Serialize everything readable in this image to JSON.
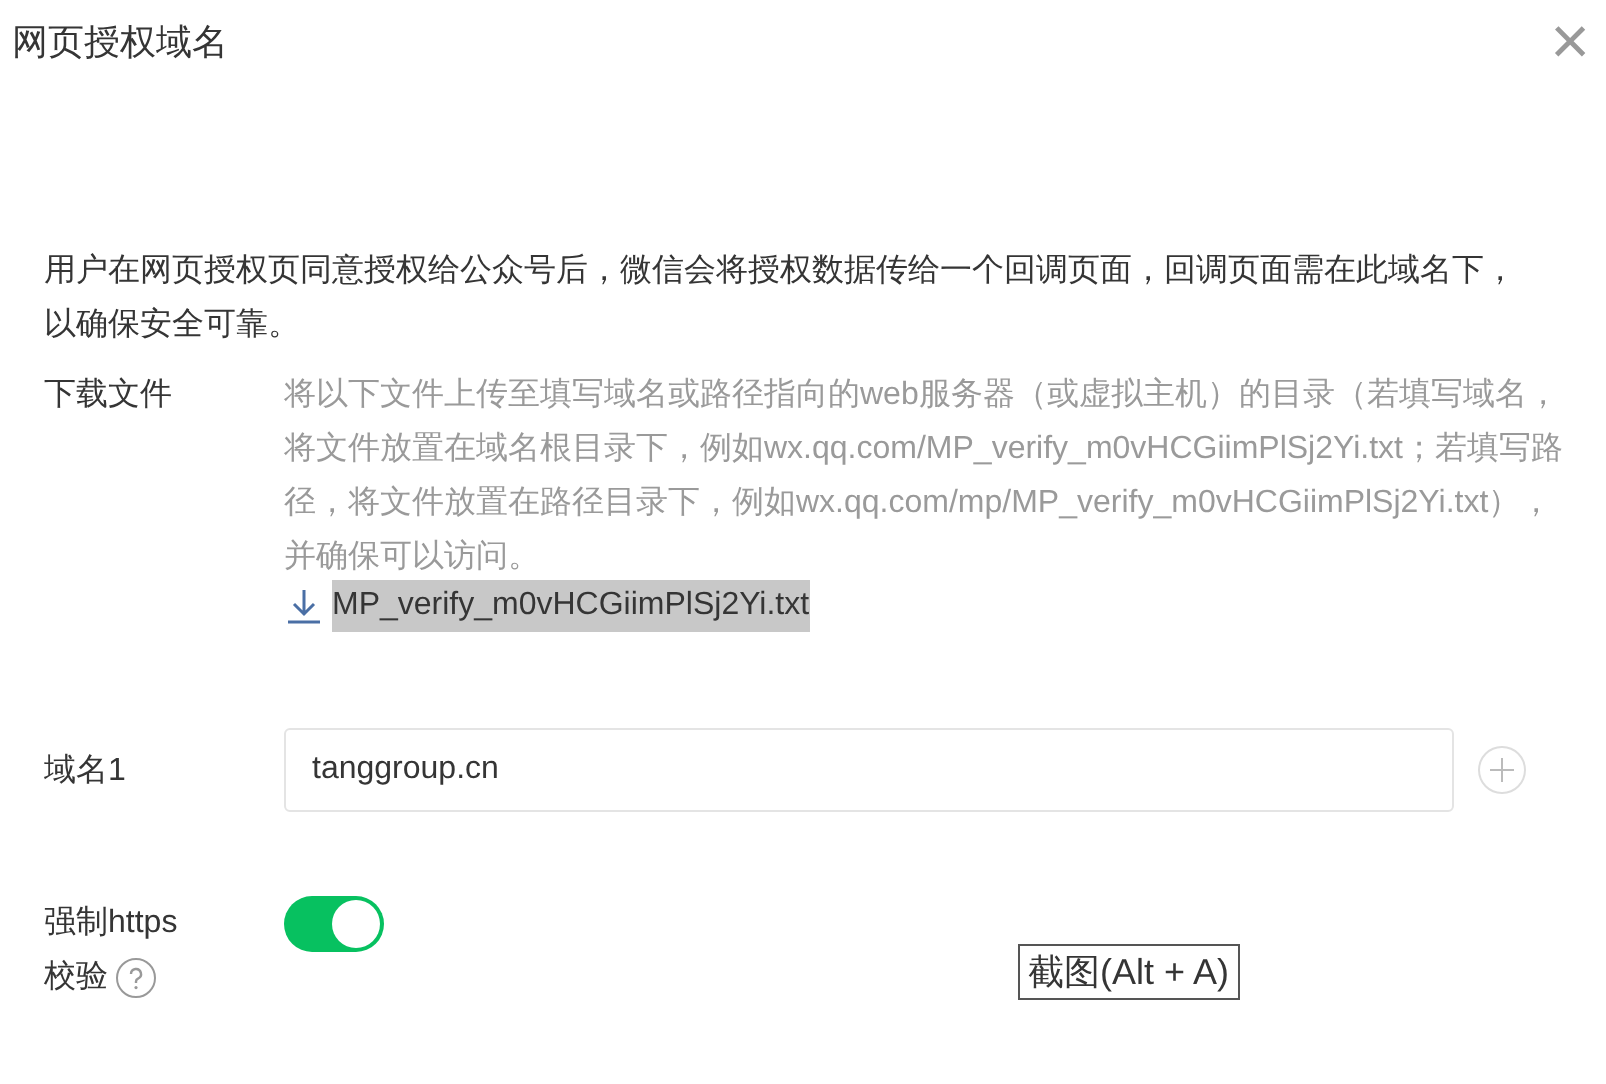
{
  "dialog": {
    "title": "网页授权域名",
    "close": "×"
  },
  "description": "用户在网页授权页同意授权给公众号后，微信会将授权数据传给一个回调页面，回调页面需在此域名下，以确保安全可靠。",
  "download": {
    "label": "下载文件",
    "instructions": "将以下文件上传至填写域名或路径指向的web服务器（或虚拟主机）的目录（若填写域名，将文件放置在域名根目录下，例如wx.qq.com/MP_verify_m0vHCGiimPlSj2Yi.txt；若填写路径，将文件放置在路径目录下，例如wx.qq.com/mp/MP_verify_m0vHCGiimPlSj2Yi.txt），并确保可以访问。",
    "file": "MP_verify_m0vHCGiimPlSj2Yi.txt",
    "file_selected": true
  },
  "domain": {
    "label": "域名1",
    "value": "tanggroup.cn"
  },
  "https": {
    "label_line_1": "强制https",
    "label_line_2": "校验",
    "on": true
  },
  "tooltip": "截图(Alt + A)"
}
